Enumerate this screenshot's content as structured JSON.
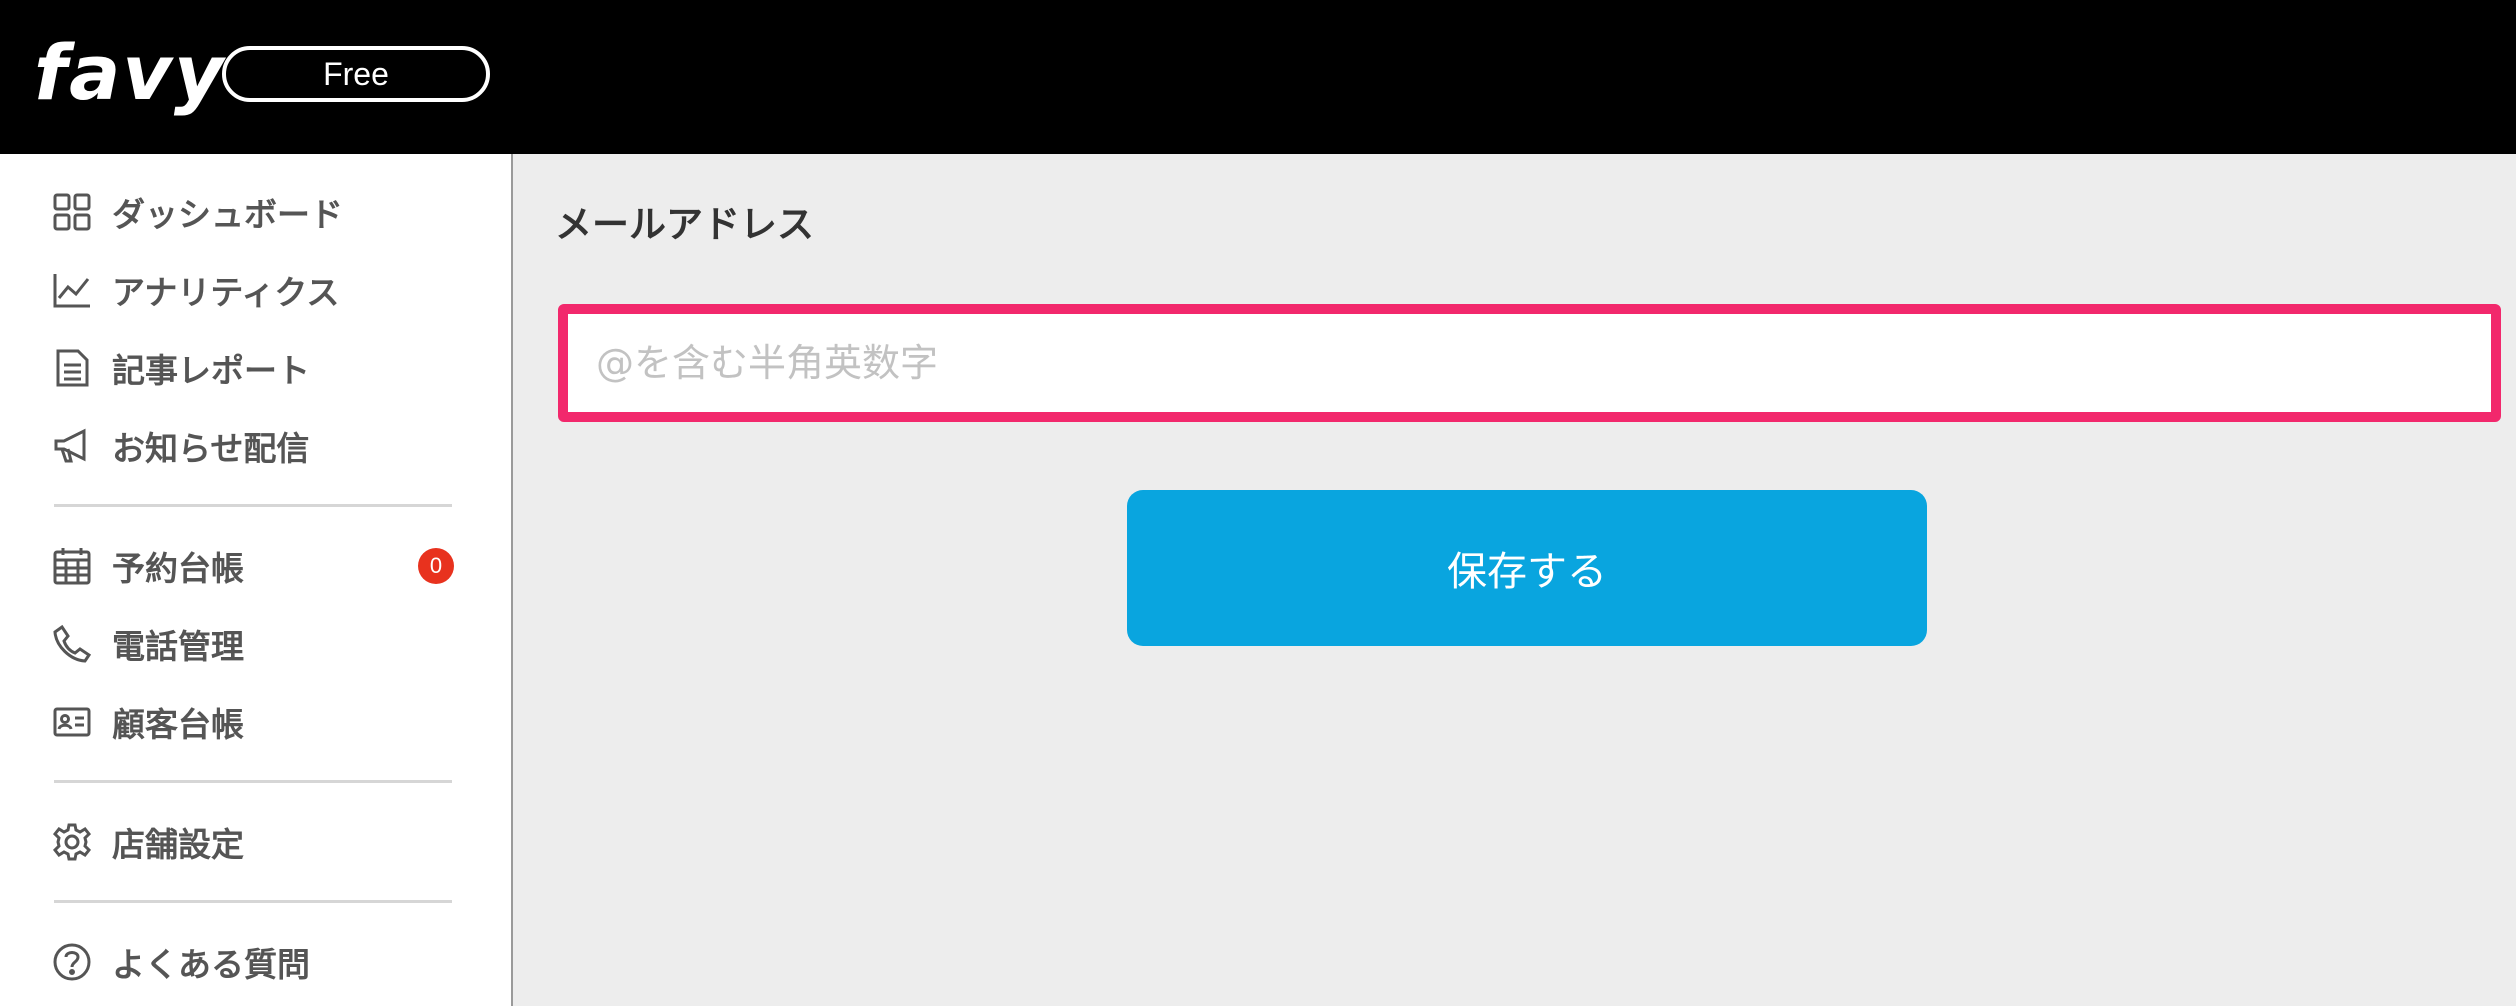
{
  "header": {
    "logo_text": "favy",
    "plan_label": "Free"
  },
  "sidebar": {
    "items": [
      {
        "label": "ダッシュボード",
        "icon": "grid-icon"
      },
      {
        "label": "アナリティクス",
        "icon": "line-chart-icon"
      },
      {
        "label": "記事レポート",
        "icon": "document-icon"
      },
      {
        "label": "お知らせ配信",
        "icon": "megaphone-icon"
      },
      {
        "label": "予約台帳",
        "icon": "calendar-icon",
        "badge": "0"
      },
      {
        "label": "電話管理",
        "icon": "phone-icon"
      },
      {
        "label": "顧客台帳",
        "icon": "id-card-icon"
      },
      {
        "label": "店舗設定",
        "icon": "gear-icon"
      },
      {
        "label": "よくある質問",
        "icon": "question-icon"
      }
    ]
  },
  "main": {
    "section_title": "メールアドレス",
    "email_placeholder": "@を含む半角英数字",
    "email_value": "",
    "save_label": "保存する"
  },
  "colors": {
    "header_bg": "#000000",
    "accent_button": "#09a5df",
    "input_highlight": "#f2286c",
    "badge": "#e8321e"
  }
}
